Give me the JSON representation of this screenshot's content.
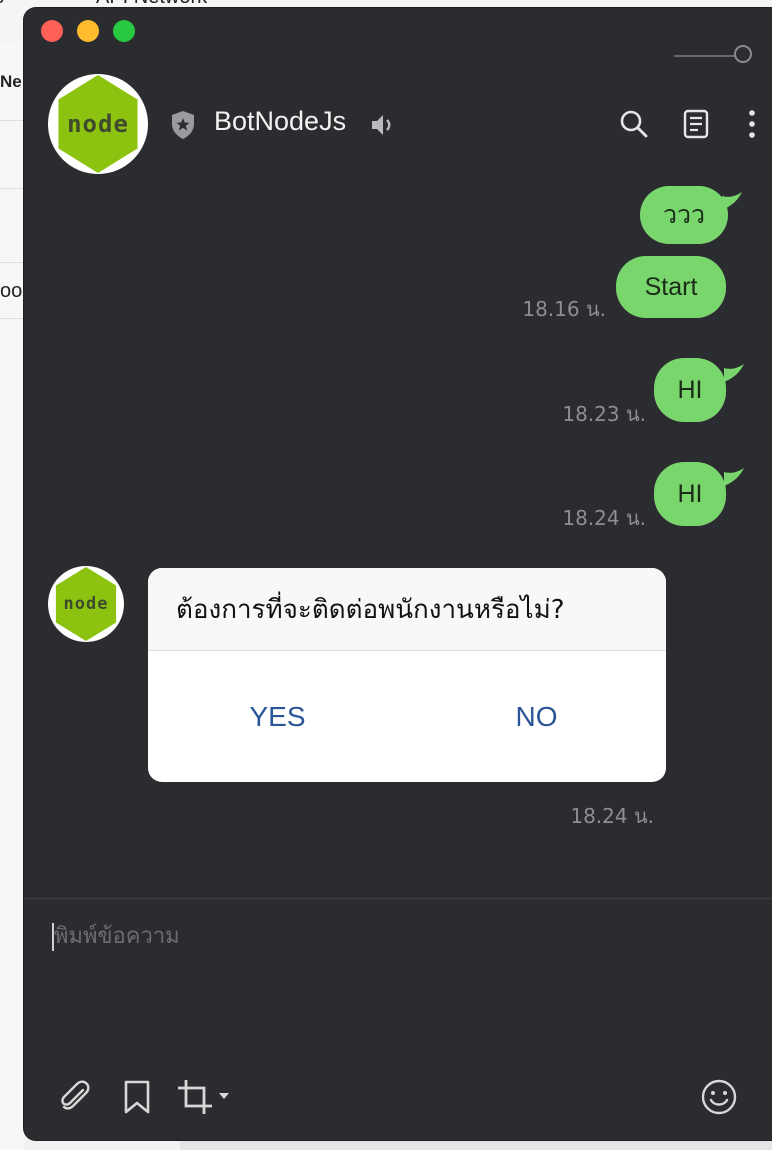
{
  "background_app": {
    "fragments": [
      "s",
      "API Network",
      "Ne",
      "oo"
    ]
  },
  "window": {
    "controls": [
      "close",
      "minimize",
      "zoom"
    ],
    "header": {
      "bot_name": "BotNodeJs",
      "avatar_text": "node",
      "icons": [
        "shield-star-icon",
        "speaker-icon",
        "search-icon",
        "note-icon",
        "more-icon"
      ]
    },
    "messages": [
      {
        "side": "right",
        "text": "ววว",
        "time": ""
      },
      {
        "side": "right",
        "text": "Start",
        "time": "18.16 น."
      },
      {
        "side": "right",
        "text": "HI",
        "time": "18.23 น."
      },
      {
        "side": "right",
        "text": "HI",
        "time": "18.24 น."
      }
    ],
    "bot_card": {
      "avatar_text": "node",
      "question": "ต้องการที่จะติดต่อพนักงานหรือไม่?",
      "buttons": [
        "YES",
        "NO"
      ],
      "time": "18.24 น."
    },
    "composer": {
      "placeholder": "พิมพ์ข้อความ",
      "tools": [
        "paperclip-icon",
        "bookmark-icon",
        "crop-icon",
        "emoji-icon"
      ]
    }
  },
  "colors": {
    "window_bg": "#2b2c2f",
    "bubble_green": "#78d66d",
    "button_text": "#2a5596",
    "node_green": "#8cc311"
  }
}
